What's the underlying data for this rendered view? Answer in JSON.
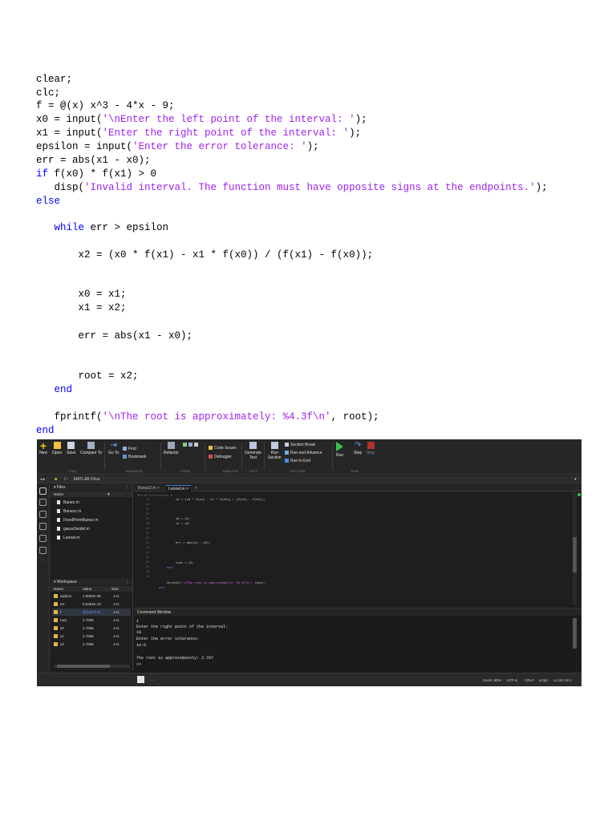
{
  "document": {
    "lines": [
      {
        "parts": [
          {
            "t": "clear;",
            "c": "plain"
          }
        ]
      },
      {
        "parts": [
          {
            "t": "clc;",
            "c": "plain"
          }
        ]
      },
      {
        "parts": [
          {
            "t": "f = @(x) x^3 - 4*x - 9;",
            "c": "plain"
          }
        ]
      },
      {
        "parts": [
          {
            "t": "x0 = input(",
            "c": "plain"
          },
          {
            "t": "'\\nEnter the left point of the interval: '",
            "c": "str"
          },
          {
            "t": ");",
            "c": "plain"
          }
        ]
      },
      {
        "parts": [
          {
            "t": "x1 = input(",
            "c": "plain"
          },
          {
            "t": "'Enter the right point of the interval: '",
            "c": "str"
          },
          {
            "t": ");",
            "c": "plain"
          }
        ]
      },
      {
        "parts": [
          {
            "t": "epsilon = input(",
            "c": "plain"
          },
          {
            "t": "'Enter the error tolerance: '",
            "c": "str"
          },
          {
            "t": ");",
            "c": "plain"
          }
        ]
      },
      {
        "parts": [
          {
            "t": "err = abs(x1 - x0);",
            "c": "plain"
          }
        ]
      },
      {
        "parts": [
          {
            "t": "if",
            "c": "kw"
          },
          {
            "t": " f(x0) * f(x1) > 0",
            "c": "plain"
          }
        ]
      },
      {
        "parts": [
          {
            "t": "   disp(",
            "c": "plain"
          },
          {
            "t": "'Invalid interval. The function must have opposite signs at the endpoints.'",
            "c": "str"
          },
          {
            "t": ");",
            "c": "plain"
          }
        ]
      },
      {
        "parts": [
          {
            "t": "else",
            "c": "kw"
          }
        ]
      },
      {
        "parts": [
          {
            "t": "   ",
            "c": "plain"
          },
          {
            "t": "while",
            "c": "kw"
          },
          {
            "t": " err > epsilon",
            "c": "plain"
          }
        ]
      },
      {
        "parts": [
          {
            "t": "       x2 = (x0 * f(x1) - x1 * f(x0)) / (f(x1) - f(x0));",
            "c": "plain"
          }
        ]
      },
      {
        "parts": [
          {
            "t": "       x0 = x1;",
            "c": "plain"
          }
        ]
      },
      {
        "parts": [
          {
            "t": "       x1 = x2;",
            "c": "plain"
          }
        ]
      },
      {
        "parts": [
          {
            "t": "       err = abs(x1 - x0);",
            "c": "plain"
          }
        ]
      },
      {
        "parts": [
          {
            "t": "       root = x2;",
            "c": "plain"
          }
        ]
      },
      {
        "parts": [
          {
            "t": "   ",
            "c": "plain"
          },
          {
            "t": "end",
            "c": "kw"
          }
        ]
      },
      {
        "parts": [
          {
            "t": "   fprintf(",
            "c": "plain"
          },
          {
            "t": "'\\nThe root is approximately: %4.3f\\n'",
            "c": "str"
          },
          {
            "t": ", root);",
            "c": "plain"
          }
        ]
      },
      {
        "parts": [
          {
            "t": "end",
            "c": "kw"
          }
        ]
      }
    ]
  },
  "matlab": {
    "toolstrip": {
      "new": "New",
      "open": "Open",
      "save": "Save",
      "compare": "Compare To",
      "goto": "Go To",
      "find": "Find",
      "bookmark": "Bookmark",
      "refactor": "Refactor",
      "code_issues": "Code Issues",
      "debugger": "Debugger",
      "generate": "Generate",
      "generate2": "Test",
      "run_section": "Run",
      "run_section2": "Section",
      "section_break": "Section Break",
      "run_advance": "Run and Advance",
      "run_end": "Run to End",
      "run": "Run",
      "step": "Step",
      "stop": "Stop",
      "sec_file": "FILE",
      "sec_navigate": "NAVIGATE",
      "sec_code": "CODE",
      "sec_analyze": "ANALYZE",
      "sec_test": "TEST",
      "sec_section": "SECTION",
      "sec_run": "RUN"
    },
    "address": {
      "path_label": "MATLAB Drive"
    },
    "files": {
      "title": "Files",
      "col_name": "Name",
      "items": [
        "Banez.m",
        "Banezz.m",
        "FixedPointBanez.m",
        "gaussSeidel.m",
        "Leonel.m"
      ]
    },
    "workspace": {
      "title": "Workspace",
      "col_name": "Name",
      "col_value": "Value",
      "col_size": "Size",
      "rows": [
        {
          "name": "epsilon",
          "value": "1.0000e-06",
          "size": "1×1"
        },
        {
          "name": "err",
          "value": "9.6282e-10",
          "size": "1×1"
        },
        {
          "name": "f",
          "value": "@(x)x^3-4*...",
          "size": "1×1"
        },
        {
          "name": "root",
          "value": "2.7065",
          "size": "1×1"
        },
        {
          "name": "x0",
          "value": "2.7065",
          "size": "1×1"
        },
        {
          "name": "x1",
          "value": "2.7065",
          "size": "1×1"
        },
        {
          "name": "x2",
          "value": "2.7065",
          "size": "1×1"
        }
      ]
    },
    "editor": {
      "tabs": [
        "Banez2.m",
        "Leonel.m"
      ],
      "path": "MATLAB Drive/Leonel.m",
      "line_numbers": [
        "23",
        "24",
        "25",
        "26",
        "27",
        "28",
        "29",
        "30",
        "31",
        "32",
        "33",
        "34",
        "35",
        "36",
        "37",
        "38",
        "39"
      ],
      "lines": [
        {
          "parts": [
            {
              "t": "x2 = (x0 * f(x1) - x1 * f(x0)) / (f(x1) - f(x0));",
              "c": "plain"
            }
          ]
        },
        {
          "parts": [
            {
              "t": "x0 = x1;",
              "c": "plain"
            }
          ]
        },
        {
          "parts": [
            {
              "t": "x1 = x2;",
              "c": "plain"
            }
          ]
        },
        {
          "parts": [
            {
              "t": "err = abs(x1 - x0);",
              "c": "plain"
            }
          ]
        },
        {
          "parts": [
            {
              "t": "root = x2;",
              "c": "plain"
            }
          ]
        },
        {
          "parts": [
            {
              "t": "end",
              "c": "kw"
            }
          ]
        },
        {
          "parts": [
            {
              "t": "fprintf(",
              "c": "plain"
            },
            {
              "t": "'\\nThe root is approximately: %4.3f\\n'",
              "c": "str"
            },
            {
              "t": ", root);",
              "c": "plain"
            }
          ]
        },
        {
          "parts": [
            {
              "t": "end",
              "c": "kw"
            }
          ]
        }
      ]
    },
    "command_window": {
      "title": "Command Window",
      "lines": [
        "1",
        "Enter the right point of the interval:",
        "10",
        "Enter the error tolerance:",
        "1e-6",
        "",
        "The root is approximately: 2.707",
        ">>"
      ]
    },
    "status": {
      "zoom": "Zoom: 80%",
      "encoding": "UTF-8",
      "eol": "CRLF",
      "type": "script",
      "pos": "Ln 29 Col 1"
    }
  }
}
